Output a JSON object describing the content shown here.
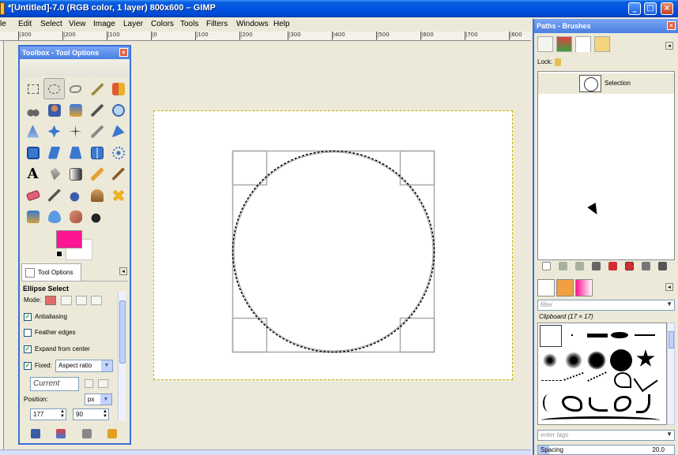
{
  "window": {
    "title": "*[Untitled]-7.0 (RGB color, 1 layer) 800x600 – GIMP",
    "buttons": {
      "minimize": "_",
      "maximize": "□",
      "close": "×"
    }
  },
  "menu": [
    "le",
    "Edit",
    "Select",
    "View",
    "Image",
    "Layer",
    "Colors",
    "Tools",
    "Filters",
    "Windows",
    "Help"
  ],
  "ruler": {
    "labels": [
      "|300",
      "|200",
      "|100",
      "|0",
      "|100",
      "|200",
      "|300",
      "|400",
      "|500",
      "|600",
      "|700",
      "|800"
    ]
  },
  "toolbox": {
    "title": "Toolbox - Tool Options",
    "close": "×",
    "tools": [
      "rect-select",
      "ellipse-select",
      "free-select",
      "fuzzy-select",
      "color-select",
      "scissors-select",
      "foreground-select",
      "paths",
      "color-picker",
      "zoom",
      "measure",
      "move",
      "align",
      "crop",
      "rotate",
      "scale",
      "shear",
      "perspective",
      "flip",
      "cage-transform",
      "text",
      "bucket-fill",
      "blend",
      "pencil",
      "paintbrush",
      "eraser",
      "airbrush",
      "ink",
      "clone",
      "heal",
      "perspective-clone",
      "blur",
      "smudge",
      "dodge-burn"
    ],
    "colors": {
      "foreground": "#ff1493",
      "background": "#ffffff"
    }
  },
  "tool_options": {
    "tab_label": "Tool Options",
    "heading": "Ellipse Select",
    "mode_label": "Mode:",
    "antialiasing": {
      "label": "Antialiasing",
      "checked": true
    },
    "feather": {
      "label": "Feather edges",
      "checked": false
    },
    "expand": {
      "label": "Expand from center",
      "checked": true
    },
    "fixed": {
      "label": "Fixed:",
      "checked": true,
      "value": "Aspect ratio"
    },
    "current": "Current",
    "position_label": "Position:",
    "unit": "px",
    "pos_x": "177",
    "pos_y": "90"
  },
  "dock": {
    "title": "Paths - Brushes",
    "close": "×",
    "lock_label": "Lock:",
    "path_name": "Selection",
    "filter_placeholder": "filter",
    "clipboard_label": "Clipboard (17 × 17)",
    "tags_placeholder": "enter tags",
    "spacing_label": "Spacing",
    "spacing_value": "20.0"
  }
}
